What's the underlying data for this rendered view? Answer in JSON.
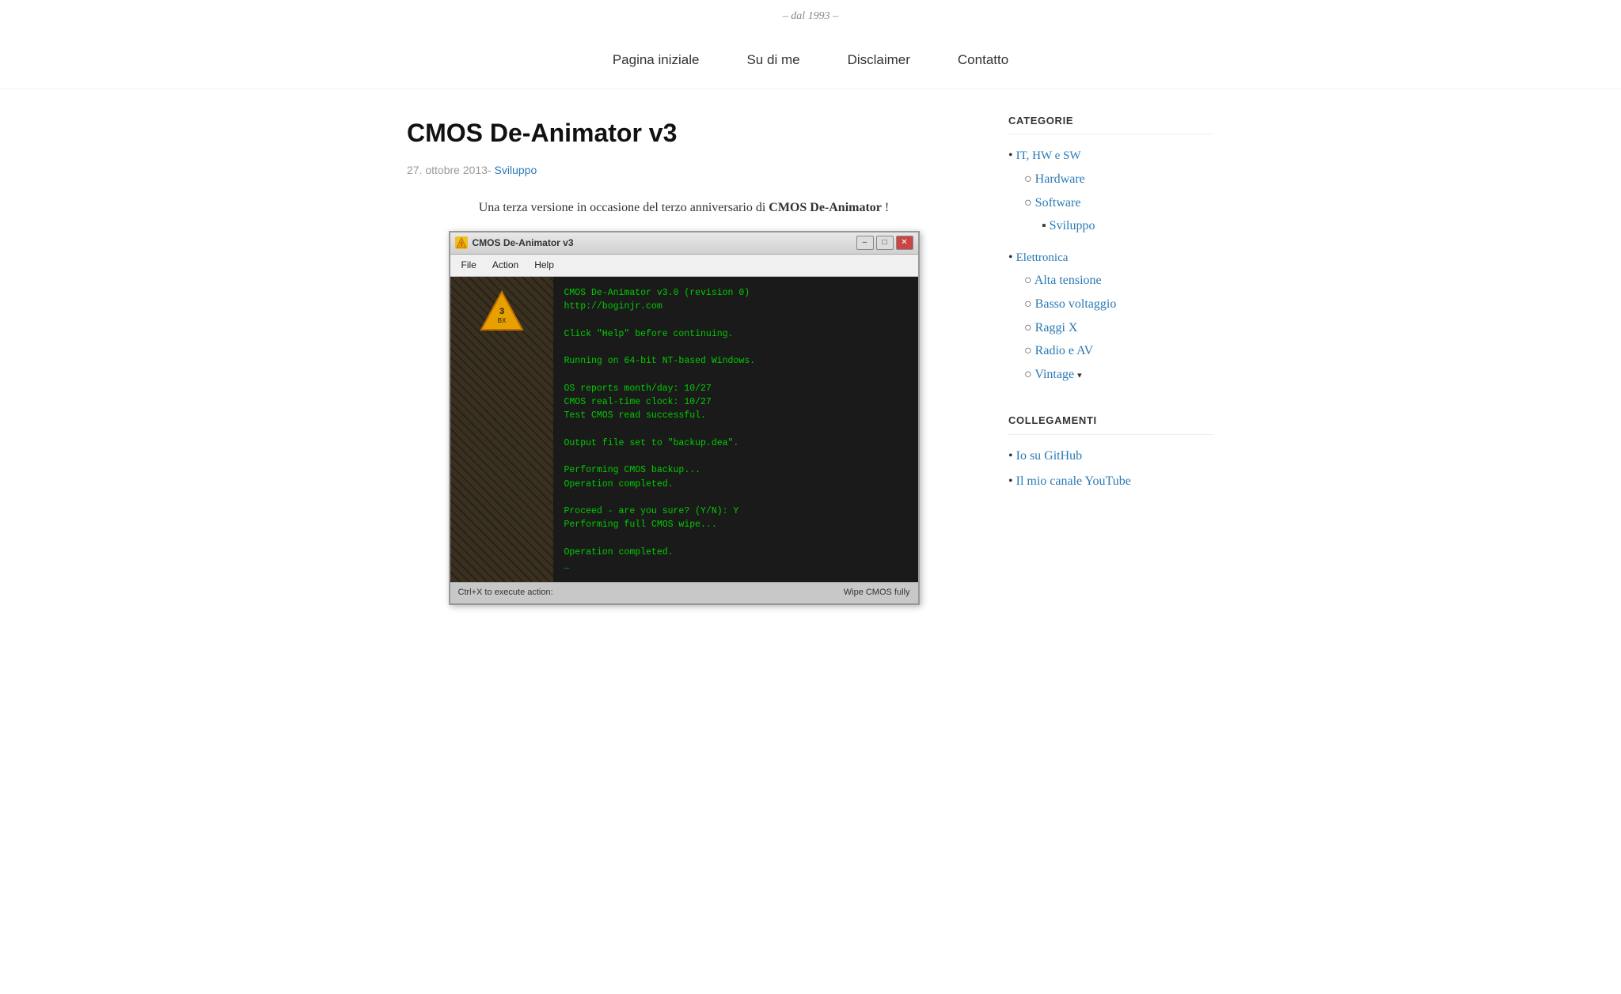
{
  "header": {
    "tagline": "– dal 1993 –",
    "nav": [
      {
        "label": "Pagina iniziale",
        "href": "#"
      },
      {
        "label": "Su di me",
        "href": "#"
      },
      {
        "label": "Disclaimer",
        "href": "#"
      },
      {
        "label": "Contatto",
        "href": "#"
      }
    ]
  },
  "post": {
    "title": "CMOS De-Animator v3",
    "date": "27. ottobre 2013",
    "category": "Sviluppo",
    "intro_before": "Una terza versione in occasione del terzo anniversario di ",
    "intro_bold": "CMOS De-Animator",
    "intro_after": " !"
  },
  "app_window": {
    "title": "CMOS De-Animator v3",
    "menu": [
      "File",
      "Action",
      "Help"
    ],
    "terminal_lines": "CMOS De-Animator v3.0 (revision 0)\nhttp://boginjr.com\n\nClick \"Help\" before continuing.\n\nRunning on 64-bit NT-based Windows.\n\nOS reports month/day: 10/27\nCMOS real-time clock: 10/27\nTest CMOS read successful.\n\nOutput file set to \"backup.dea\".\n\nPerforming CMOS backup...\nOperation completed.\n\nProceed - are you sure? (Y/N): Y\nPerforming full CMOS wipe...\n\nOperation completed.\n_",
    "status_left": "Ctrl+X to execute action:",
    "status_right": "Wipe CMOS fully"
  },
  "sidebar": {
    "categories_heading": "CATEGORIE",
    "categories": [
      {
        "label": "IT, HW e SW",
        "children": [
          {
            "label": "Hardware",
            "children": []
          },
          {
            "label": "Software",
            "children": [
              {
                "label": "Sviluppo"
              }
            ]
          }
        ]
      },
      {
        "label": "Elettronica",
        "children": [
          {
            "label": "Alta tensione",
            "children": []
          },
          {
            "label": "Basso voltaggio",
            "children": []
          },
          {
            "label": "Raggi X",
            "children": []
          },
          {
            "label": "Radio e AV",
            "children": []
          },
          {
            "label": "Vintage",
            "children": [],
            "toggle": true
          }
        ]
      }
    ],
    "links_heading": "COLLEGAMENTI",
    "links": [
      {
        "label": "Io su GitHub"
      },
      {
        "label": "Il mio canale YouTube"
      }
    ]
  }
}
